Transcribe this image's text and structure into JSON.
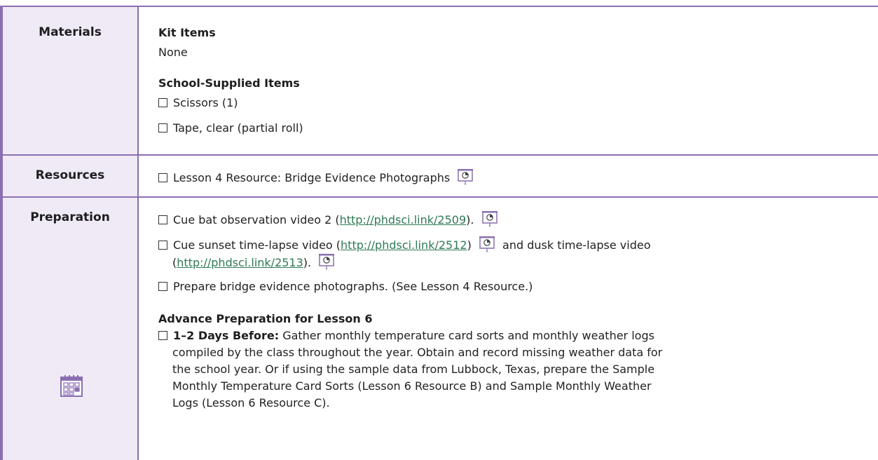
{
  "materials": {
    "label": "Materials",
    "kit_heading": "Kit Items",
    "kit_text": "None",
    "school_heading": "School-Supplied Items",
    "items": [
      "Scissors (1)",
      "Tape, clear (partial roll)"
    ]
  },
  "resources": {
    "label": "Resources",
    "item": "Lesson 4 Resource: Bridge Evidence Photographs"
  },
  "preparation": {
    "label": "Preparation",
    "p1_a": "Cue bat observation video 2 (",
    "p1_link": "http://phdsci.link/2509",
    "p1_b": ").",
    "p2_a": "Cue sunset time-lapse video (",
    "p2_link1": "http://phdsci.link/2512",
    "p2_b": ")",
    "p2_c": "and dusk time-lapse video",
    "p2_d": "(",
    "p2_link2": "http://phdsci.link/2513",
    "p2_e": ").",
    "p3": "Prepare bridge evidence photographs. (See Lesson 4 Resource.)",
    "advance_heading": "Advance Preparation for Lesson 6",
    "adv_bold": "1–2 Days Before:",
    "adv_l1": "Gather monthly temperature card sorts and monthly weather logs",
    "adv_l2": "compiled by the class throughout the year. Obtain and record missing weather data for",
    "adv_l3": "the school year. Or if using the sample data from Lubbock, Texas, prepare the Sample",
    "adv_l4": "Monthly Temperature Card Sorts (Lesson 6 Resource B) and Sample Monthly Weather",
    "adv_l5": "Logs (Lesson 6 Resource C)."
  },
  "colors": {
    "border": "#8a6fb0",
    "label_bg": "#efeaf6",
    "link": "#2f7a55"
  },
  "icons": {
    "projector": "projector-icon",
    "calendar": "calendar-icon"
  }
}
